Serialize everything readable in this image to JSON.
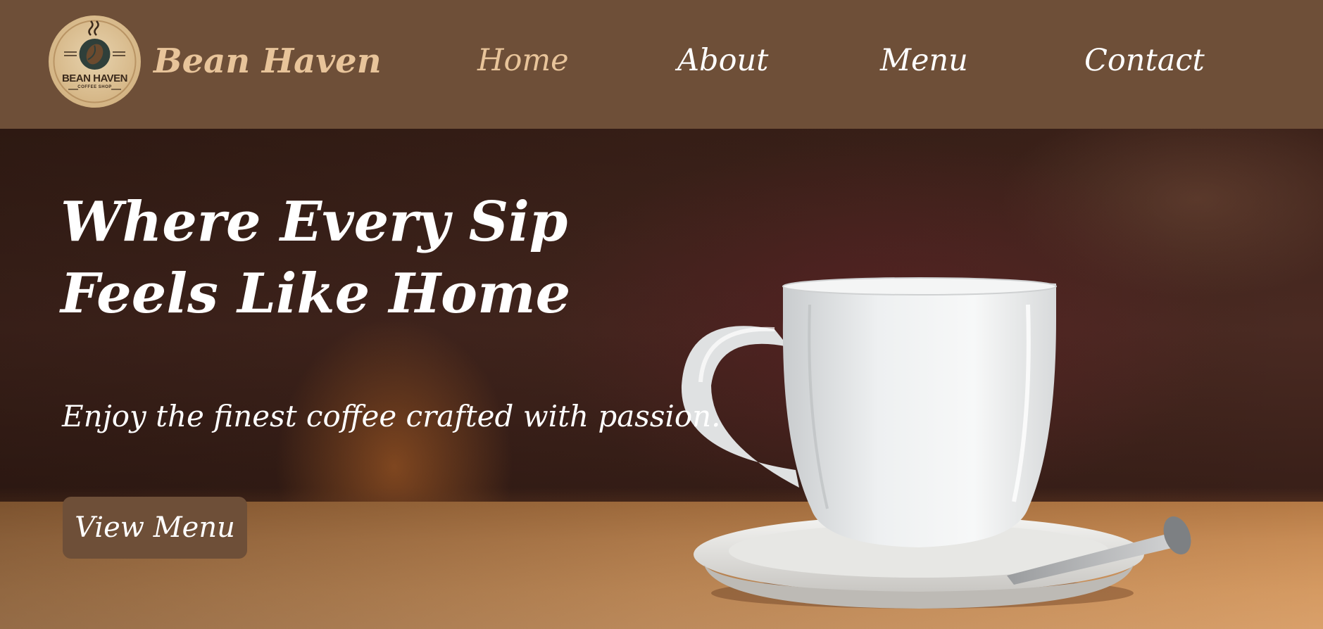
{
  "header": {
    "logo": {
      "icon": "coffee-cup-icon",
      "text_main": "BEAN HAVEN",
      "text_sub": "COFFEE SHOP"
    },
    "brand": "Bean Haven",
    "nav": [
      {
        "label": "Home",
        "active": true
      },
      {
        "label": "About",
        "active": false
      },
      {
        "label": "Menu",
        "active": false
      },
      {
        "label": "Contact",
        "active": false
      }
    ]
  },
  "hero": {
    "title": "Where Every Sip Feels Like Home",
    "subtitle": "Enjoy the finest coffee crafted with passion.",
    "cta_label": "View Menu",
    "image": "coffee-cup-on-saucer"
  },
  "colors": {
    "header_bg": "#6e4f38",
    "accent": "#e8c49a",
    "text": "#ffffff",
    "button_bg": "#6e4f38"
  }
}
